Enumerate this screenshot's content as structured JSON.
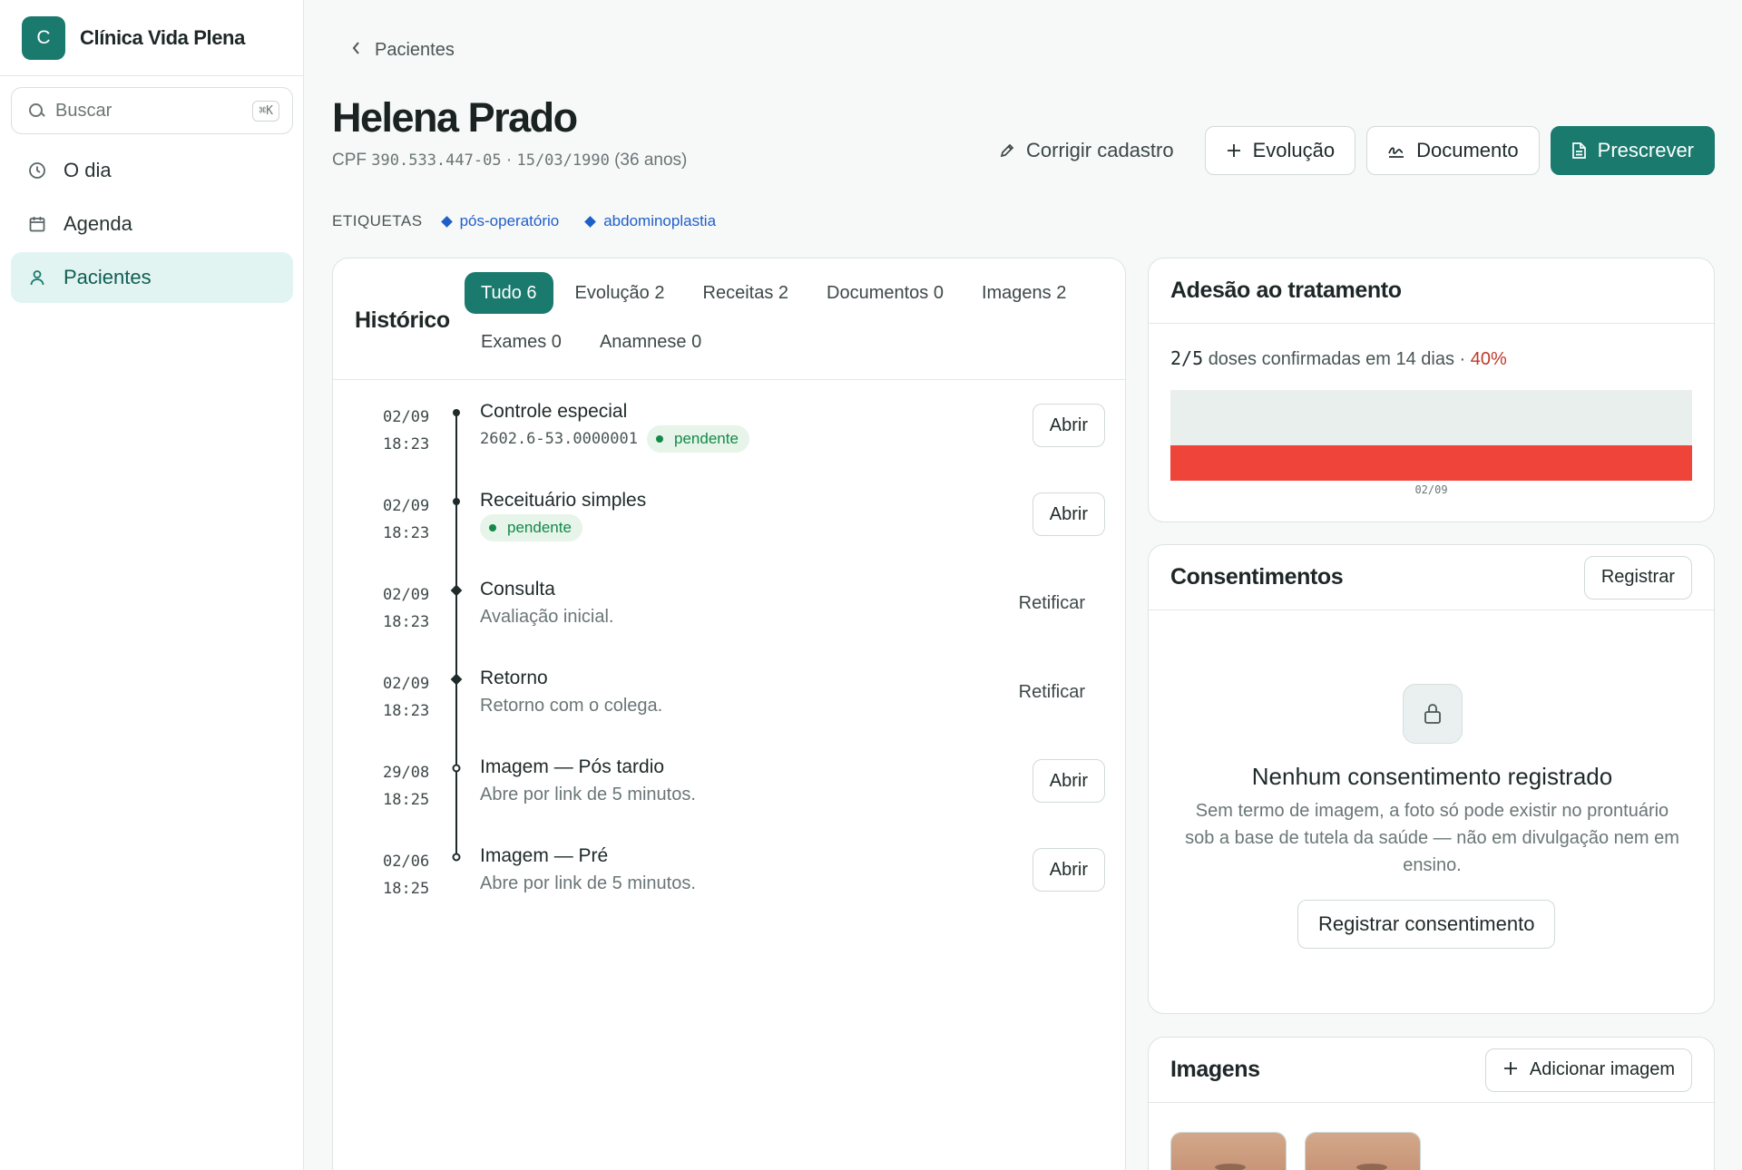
{
  "app": {
    "logo_letter": "C",
    "name": "Clínica Vida Plena"
  },
  "search": {
    "placeholder": "Buscar",
    "shortcut": "⌘K"
  },
  "nav": {
    "items": [
      {
        "label": "O dia",
        "icon": "clock-icon"
      },
      {
        "label": "Agenda",
        "icon": "calendar-icon"
      },
      {
        "label": "Pacientes",
        "icon": "user-icon",
        "active": true
      }
    ]
  },
  "breadcrumb": {
    "back_label": "Pacientes"
  },
  "patient": {
    "name": "Helena Prado",
    "cpf_label": "CPF",
    "cpf": "390.533.447-05",
    "sep": "·",
    "birth": "15/03/1990",
    "age": "(36 anos)"
  },
  "actions": {
    "edit": "Corrigir cadastro",
    "evolution": "Evolução",
    "document": "Documento",
    "prescribe": "Prescrever"
  },
  "tags": {
    "label": "ETIQUETAS",
    "items": [
      "pós-operatório",
      "abdominoplastia"
    ]
  },
  "history": {
    "title": "Histórico",
    "tabs": [
      {
        "label": "Tudo 6",
        "active": true
      },
      {
        "label": "Evolução 2"
      },
      {
        "label": "Receitas 2"
      },
      {
        "label": "Documentos 0"
      },
      {
        "label": "Imagens 2"
      },
      {
        "label": "Exames 0"
      },
      {
        "label": "Anamnese 0"
      }
    ],
    "entries": [
      {
        "date": "02/09",
        "time": "18:23",
        "marker": "dot",
        "title": "Controle especial",
        "code": "2602.6-53.0000001",
        "badge": "pendente",
        "subtitle": "",
        "action": "Abrir",
        "action_style": "button"
      },
      {
        "date": "02/09",
        "time": "18:23",
        "marker": "dot",
        "title": "Receituário simples",
        "code": "",
        "badge": "pendente",
        "subtitle": "",
        "action": "Abrir",
        "action_style": "button"
      },
      {
        "date": "02/09",
        "time": "18:23",
        "marker": "diamond",
        "title": "Consulta",
        "code": "",
        "badge": "",
        "subtitle": "Avaliação inicial.",
        "action": "Retificar",
        "action_style": "plain"
      },
      {
        "date": "02/09",
        "time": "18:23",
        "marker": "diamond",
        "title": "Retorno",
        "code": "",
        "badge": "",
        "subtitle": "Retorno com o colega.",
        "action": "Retificar",
        "action_style": "plain"
      },
      {
        "date": "29/08",
        "time": "18:25",
        "marker": "ring",
        "title": "Imagem — Pós tardio",
        "code": "",
        "badge": "",
        "subtitle": "Abre por link de 5 minutos.",
        "action": "Abrir",
        "action_style": "button"
      },
      {
        "date": "02/06",
        "time": "18:25",
        "marker": "ring",
        "title": "Imagem — Pré",
        "code": "",
        "badge": "",
        "subtitle": "Abre por link de 5 minutos.",
        "action": "Abrir",
        "action_style": "button"
      }
    ]
  },
  "adherence": {
    "title": "Adesão ao tratamento",
    "confirmed": "2/5",
    "summary_text": "doses confirmadas em 14 dias ·",
    "percent": "40%",
    "colors": {
      "bar": "#ef443a",
      "background": "#e9efed"
    }
  },
  "chart_data": {
    "type": "bar",
    "categories": [
      "02/09"
    ],
    "values": [
      0.4
    ],
    "ylim": [
      0,
      1
    ],
    "title": "",
    "xlabel": "",
    "ylabel": ""
  },
  "consent": {
    "title": "Consentimentos",
    "register_label": "Registrar",
    "empty_title": "Nenhum consentimento registrado",
    "empty_text": "Sem termo de imagem, a foto só pode existir no prontuário sob a base de tutela da saúde — não em divulgação nem em ensino.",
    "cta": "Registrar consentimento"
  },
  "images": {
    "title": "Imagens",
    "add_label": "Adicionar imagem",
    "thumbnails": [
      "thumbnail-face",
      "thumbnail-face"
    ]
  },
  "colors": {
    "accent": "#1a7a6e",
    "tag": "#1f5fc9",
    "pending": "#138a47"
  }
}
